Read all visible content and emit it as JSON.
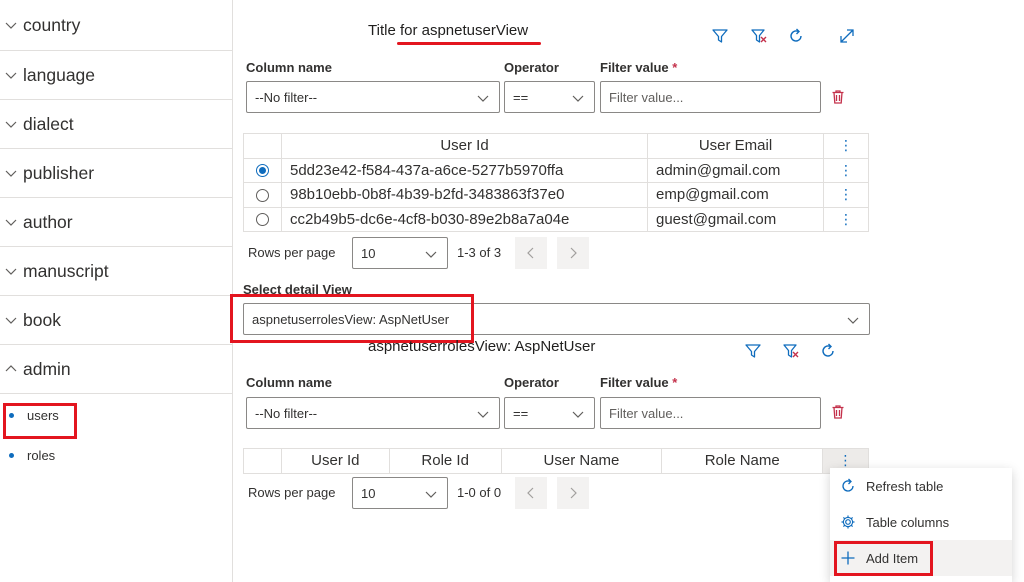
{
  "sidebar": {
    "items": [
      {
        "label": "country",
        "expanded": false
      },
      {
        "label": "language",
        "expanded": false
      },
      {
        "label": "dialect",
        "expanded": false
      },
      {
        "label": "publisher",
        "expanded": false
      },
      {
        "label": "author",
        "expanded": false
      },
      {
        "label": "manuscript",
        "expanded": false
      },
      {
        "label": "book",
        "expanded": false
      },
      {
        "label": "admin",
        "expanded": true
      }
    ],
    "sub_items": [
      {
        "label": "users"
      },
      {
        "label": "roles"
      }
    ]
  },
  "master": {
    "title": "Title for aspnetuserView",
    "filter": {
      "column_label": "Column name",
      "column_value": "--No filter--",
      "operator_label": "Operator",
      "operator_value": "==",
      "value_label": "Filter value",
      "required_mark": "*",
      "value_placeholder": "Filter value..."
    },
    "table": {
      "headers": [
        "User Id",
        "User Email"
      ],
      "more_glyph": "⋮",
      "rows": [
        {
          "selected": true,
          "id": "5dd23e42-f584-437a-a6ce-5277b5970ffa",
          "email": "admin@gmail.com"
        },
        {
          "selected": false,
          "id": "98b10ebb-0b8f-4b39-b2fd-3483863f37e0",
          "email": "emp@gmail.com"
        },
        {
          "selected": false,
          "id": "cc2b49b5-dc6e-4cf8-b030-89e2b8a7a04e",
          "email": "guest@gmail.com"
        }
      ]
    },
    "pagination": {
      "rows_per_page_label": "Rows per page",
      "rows_per_page": "10",
      "range": "1-3 of 3"
    }
  },
  "detail_select": {
    "label": "Select detail View",
    "value": "aspnetuserrolesView: AspNetUser"
  },
  "detail": {
    "title": "aspnetuserrolesView: AspNetUser",
    "filter": {
      "column_label": "Column name",
      "column_value": "--No filter--",
      "operator_label": "Operator",
      "operator_value": "==",
      "value_label": "Filter value",
      "required_mark": "*",
      "value_placeholder": "Filter value..."
    },
    "table": {
      "headers": [
        "User Id",
        "Role Id",
        "User Name",
        "Role Name"
      ],
      "more_glyph": "⋮"
    },
    "pagination": {
      "rows_per_page_label": "Rows per page",
      "rows_per_page": "10",
      "range": "1-0 of 0"
    }
  },
  "context_menu": {
    "items": [
      {
        "label": "Refresh table",
        "icon": "refresh-icon"
      },
      {
        "label": "Table columns",
        "icon": "gear-icon"
      },
      {
        "label": "Add Item",
        "icon": "plus-icon"
      }
    ]
  },
  "colors": {
    "accent": "#0f6cbd",
    "danger": "#c4314b",
    "highlight": "#e3151f"
  }
}
